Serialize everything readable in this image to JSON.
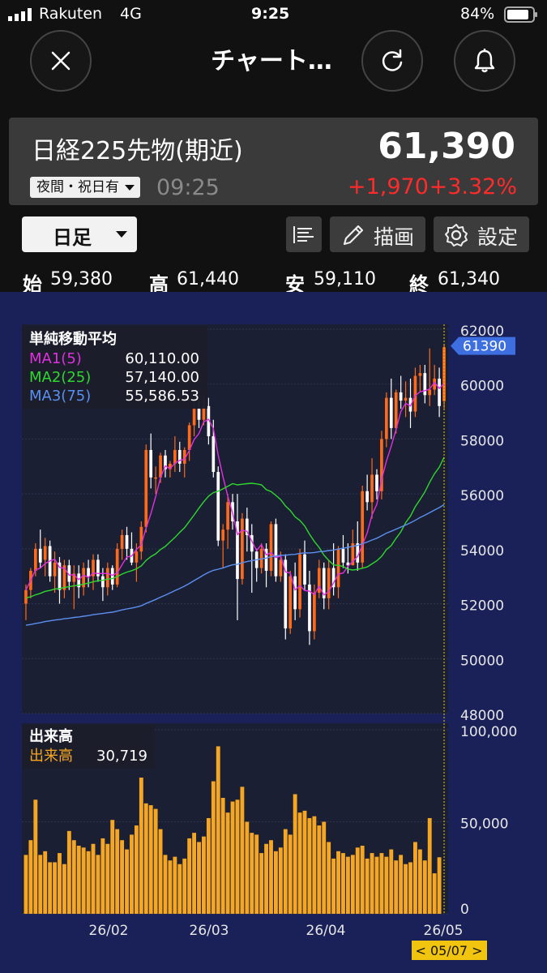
{
  "status_bar": {
    "carrier": "Rakuten",
    "network": "4G",
    "time": "9:25",
    "battery": "84%"
  },
  "nav": {
    "title": "チャート…",
    "close_icon": "close-icon",
    "refresh_icon": "refresh-icon",
    "bell_icon": "bell-icon"
  },
  "instrument": {
    "name": "日経225先物(期近)",
    "price": "61,390",
    "session_label": "夜間・祝日有",
    "time": "09:25",
    "change": "+1,970",
    "change_pct": "+3.32%",
    "up_color": "#ff2a2a"
  },
  "toolbar": {
    "period": "日足",
    "draw_label": "描画",
    "settings_label": "設定"
  },
  "ohlc": {
    "open_label": "始",
    "open": "59,380",
    "high_label": "高",
    "high": "61,440",
    "low_label": "安",
    "low": "59,110",
    "close_label": "終",
    "close": "61,340"
  },
  "chart_data": [
    {
      "type": "candlestick",
      "title": "単純移動平均",
      "ylim": [
        48000,
        62000
      ],
      "y_ticks": [
        "62000",
        "60000",
        "58000",
        "56000",
        "54000",
        "52000",
        "50000",
        "48000"
      ],
      "x_ticks": [
        "26/02",
        "26/03",
        "26/04",
        "26/05"
      ],
      "last_price_label": "61390",
      "selected_date_label": "< 05/07 >",
      "legend": [
        {
          "name": "MA1(5)",
          "value": "60,110.00",
          "color": "#e030e0"
        },
        {
          "name": "MA2(25)",
          "value": "57,140.00",
          "color": "#2ed82e"
        },
        {
          "name": "MA3(75)",
          "value": "55,586.53",
          "color": "#5b8ff0"
        }
      ],
      "colors": {
        "up": "#ff6a1a",
        "down": "#ffffff",
        "background": "#1a2158"
      },
      "candles": [
        [
          52000,
          52700,
          51400,
          52500
        ],
        [
          52500,
          53300,
          52200,
          53200
        ],
        [
          53200,
          54200,
          53000,
          54000
        ],
        [
          54000,
          54700,
          53300,
          53500
        ],
        [
          53600,
          54400,
          53000,
          54100
        ],
        [
          54100,
          54300,
          52800,
          53000
        ],
        [
          53000,
          53900,
          52400,
          53500
        ],
        [
          53500,
          53700,
          52000,
          52500
        ],
        [
          52500,
          53600,
          52200,
          53400
        ],
        [
          53400,
          53600,
          52500,
          52800
        ],
        [
          52800,
          53400,
          51800,
          53100
        ],
        [
          53100,
          53400,
          52200,
          52600
        ],
        [
          52600,
          53500,
          52300,
          53300
        ],
        [
          53300,
          53600,
          52600,
          53000
        ],
        [
          53000,
          53800,
          52500,
          53600
        ],
        [
          53600,
          53800,
          52800,
          53000
        ],
        [
          53000,
          53300,
          52100,
          52600
        ],
        [
          52600,
          53500,
          52300,
          53300
        ],
        [
          53300,
          53400,
          52500,
          52700
        ],
        [
          52700,
          54200,
          52600,
          54000
        ],
        [
          54000,
          54700,
          53600,
          54500
        ],
        [
          54500,
          54800,
          53600,
          54000
        ],
        [
          54000,
          54600,
          53400,
          53500
        ],
        [
          53500,
          54200,
          52800,
          53900
        ],
        [
          53900,
          55000,
          53600,
          54800
        ],
        [
          54800,
          57800,
          54600,
          57600
        ],
        [
          57600,
          58200,
          56200,
          56600
        ],
        [
          56600,
          57000,
          56000,
          56600
        ],
        [
          56600,
          57500,
          56400,
          57400
        ],
        [
          57400,
          57600,
          56600,
          56900
        ],
        [
          56900,
          57200,
          56600,
          57100
        ],
        [
          57100,
          58100,
          56800,
          57600
        ],
        [
          57600,
          57900,
          56800,
          57100
        ],
        [
          57100,
          57700,
          56600,
          57600
        ],
        [
          57600,
          58600,
          57200,
          58500
        ],
        [
          58500,
          59300,
          58100,
          59100
        ],
        [
          59100,
          59400,
          58400,
          58700
        ],
        [
          58700,
          59600,
          58500,
          59200
        ],
        [
          59200,
          59500,
          57800,
          58100
        ],
        [
          58100,
          58700,
          56600,
          56800
        ],
        [
          56800,
          57000,
          54100,
          54300
        ],
        [
          54300,
          54900,
          53300,
          54700
        ],
        [
          54700,
          56000,
          54000,
          55700
        ],
        [
          55700,
          56000,
          54700,
          55000
        ],
        [
          55000,
          56000,
          51400,
          52900
        ],
        [
          52900,
          55300,
          52700,
          55100
        ],
        [
          55100,
          55500,
          53900,
          54500
        ],
        [
          54500,
          54900,
          52400,
          53900
        ],
        [
          53900,
          54000,
          52800,
          53300
        ],
        [
          53300,
          54200,
          53100,
          54000
        ],
        [
          54000,
          54200,
          52600,
          53200
        ],
        [
          53200,
          55000,
          53000,
          54900
        ],
        [
          54900,
          55100,
          52800,
          53000
        ],
        [
          53000,
          53900,
          52800,
          53600
        ],
        [
          53600,
          53800,
          50700,
          51100
        ],
        [
          51100,
          53200,
          50900,
          53000
        ],
        [
          53000,
          53500,
          51400,
          51800
        ],
        [
          51800,
          54000,
          51500,
          53800
        ],
        [
          53800,
          54300,
          52500,
          52700
        ],
        [
          52700,
          53200,
          50500,
          51000
        ],
        [
          51000,
          52700,
          50700,
          52400
        ],
        [
          52400,
          53600,
          52200,
          53300
        ],
        [
          53300,
          53500,
          51800,
          52200
        ],
        [
          52200,
          53600,
          51800,
          53300
        ],
        [
          53300,
          54200,
          52300,
          52600
        ],
        [
          52600,
          54100,
          52200,
          54000
        ],
        [
          54000,
          54500,
          53300,
          53500
        ],
        [
          53500,
          54200,
          53100,
          53400
        ],
        [
          53400,
          54700,
          53400,
          54200
        ],
        [
          54200,
          55000,
          53200,
          53500
        ],
        [
          53500,
          56300,
          53300,
          56100
        ],
        [
          56100,
          56700,
          55400,
          55700
        ],
        [
          55700,
          57300,
          55100,
          56700
        ],
        [
          56700,
          56900,
          55800,
          56100
        ],
        [
          56100,
          58300,
          55800,
          58000
        ],
        [
          58000,
          59700,
          57700,
          59500
        ],
        [
          59500,
          60200,
          58000,
          58400
        ],
        [
          58400,
          59800,
          58200,
          59700
        ],
        [
          59700,
          60300,
          59100,
          59400
        ],
        [
          59400,
          60100,
          58800,
          59500
        ],
        [
          59500,
          60200,
          58400,
          59000
        ],
        [
          59000,
          60600,
          58800,
          60300
        ],
        [
          60300,
          60700,
          59700,
          60400
        ],
        [
          60400,
          60700,
          59300,
          59600
        ],
        [
          59600,
          61300,
          59200,
          59800
        ],
        [
          59800,
          60700,
          59600,
          60200
        ],
        [
          60200,
          60600,
          58800,
          59200
        ],
        [
          59380,
          61440,
          59110,
          61340
        ]
      ]
    },
    {
      "type": "bar",
      "title": "出来高",
      "legend": [
        {
          "name": "出来高",
          "value": "30,719",
          "color": "#f5a623"
        }
      ],
      "ylim": [
        0,
        100000
      ],
      "y_ticks": [
        "100,000",
        "50,000",
        "0"
      ],
      "values": [
        32000,
        40000,
        62000,
        32000,
        34000,
        28000,
        28000,
        33000,
        27000,
        45000,
        40000,
        37000,
        36000,
        34000,
        38000,
        32000,
        41000,
        38000,
        51000,
        46000,
        40000,
        35000,
        43000,
        48000,
        74000,
        60000,
        59000,
        57000,
        46000,
        32000,
        29000,
        31000,
        27000,
        30000,
        41000,
        44000,
        39000,
        42000,
        52000,
        72000,
        91000,
        63000,
        55000,
        61000,
        62000,
        69000,
        50000,
        44000,
        43000,
        33000,
        38000,
        40000,
        34000,
        36000,
        46000,
        43000,
        65000,
        55000,
        56000,
        52000,
        53000,
        48000,
        50000,
        39000,
        30000,
        34000,
        33000,
        31000,
        32000,
        36000,
        37000,
        30000,
        33000,
        31000,
        33000,
        31000,
        35000,
        29000,
        32000,
        27000,
        28000,
        39000,
        35000,
        29000,
        52000,
        22000,
        30719
      ]
    }
  ]
}
